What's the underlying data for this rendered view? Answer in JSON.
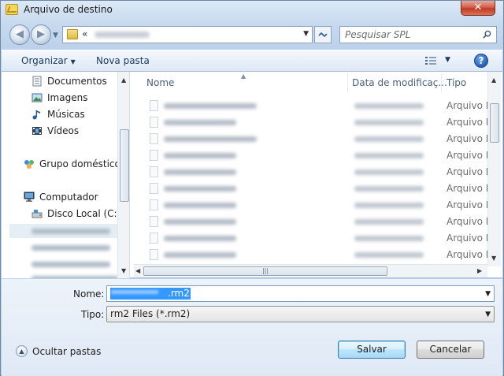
{
  "window": {
    "title": "Arquivo de destino",
    "close_label": "✕"
  },
  "nav": {
    "address_prefix": "«",
    "search_placeholder": "Pesquisar SPL"
  },
  "toolbar": {
    "organize_label": "Organizar",
    "new_folder_label": "Nova pasta",
    "help_label": "?"
  },
  "sidebar": {
    "items": [
      {
        "label": "Documentos",
        "icon": "documents-icon"
      },
      {
        "label": "Imagens",
        "icon": "pictures-icon"
      },
      {
        "label": "Músicas",
        "icon": "music-icon"
      },
      {
        "label": "Vídeos",
        "icon": "videos-icon"
      },
      {
        "label": "Grupo doméstico",
        "icon": "homegroup-icon"
      },
      {
        "label": "Computador",
        "icon": "computer-icon"
      },
      {
        "label": "Disco Local (C:)",
        "icon": "local-disk-icon"
      }
    ]
  },
  "file_list": {
    "columns": [
      "Nome",
      "Data de modificaç...",
      "Tipo"
    ],
    "rows": [
      {
        "type": "Arquivo R"
      },
      {
        "type": "Arquivo R"
      },
      {
        "type": "Arquivo R"
      },
      {
        "type": "Arquivo R"
      },
      {
        "type": "Arquivo R"
      },
      {
        "type": "Arquivo R"
      },
      {
        "type": "Arquivo R"
      },
      {
        "type": "Arquivo R"
      },
      {
        "type": "Arquivo R"
      },
      {
        "type": "Arquivo R"
      }
    ]
  },
  "form": {
    "name_label": "Nome:",
    "name_extension": ".rm2",
    "type_label": "Tipo:",
    "type_value": "rm2 Files (*.rm2)"
  },
  "footer": {
    "hide_folders_label": "Ocultar pastas",
    "save_label": "Salvar",
    "cancel_label": "Cancelar"
  }
}
